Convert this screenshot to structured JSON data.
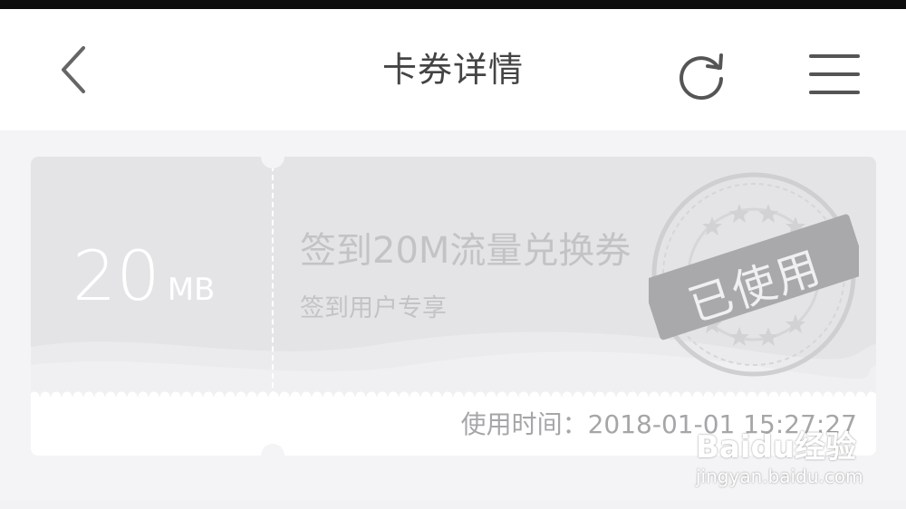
{
  "header": {
    "title": "卡券详情",
    "back_icon": "chevron-left-icon",
    "refresh_icon": "refresh-icon",
    "menu_icon": "hamburger-menu-icon"
  },
  "coupon": {
    "amount": "20",
    "unit": "MB",
    "name": "签到20M流量兑换券",
    "subtitle": "签到用户专享",
    "usage_time": "使用时间：2018-01-01 15:27:27",
    "stamp": "已使用"
  },
  "watermark": {
    "brand": "Baidu经验",
    "site": "jingyan.baidu.com"
  },
  "colors": {
    "nav_background": "#ffffff",
    "page_background": "#f4f4f6",
    "coupon_used": "#e4e4e6",
    "title_text": "#444444",
    "muted_text": "#c3c3c5"
  }
}
